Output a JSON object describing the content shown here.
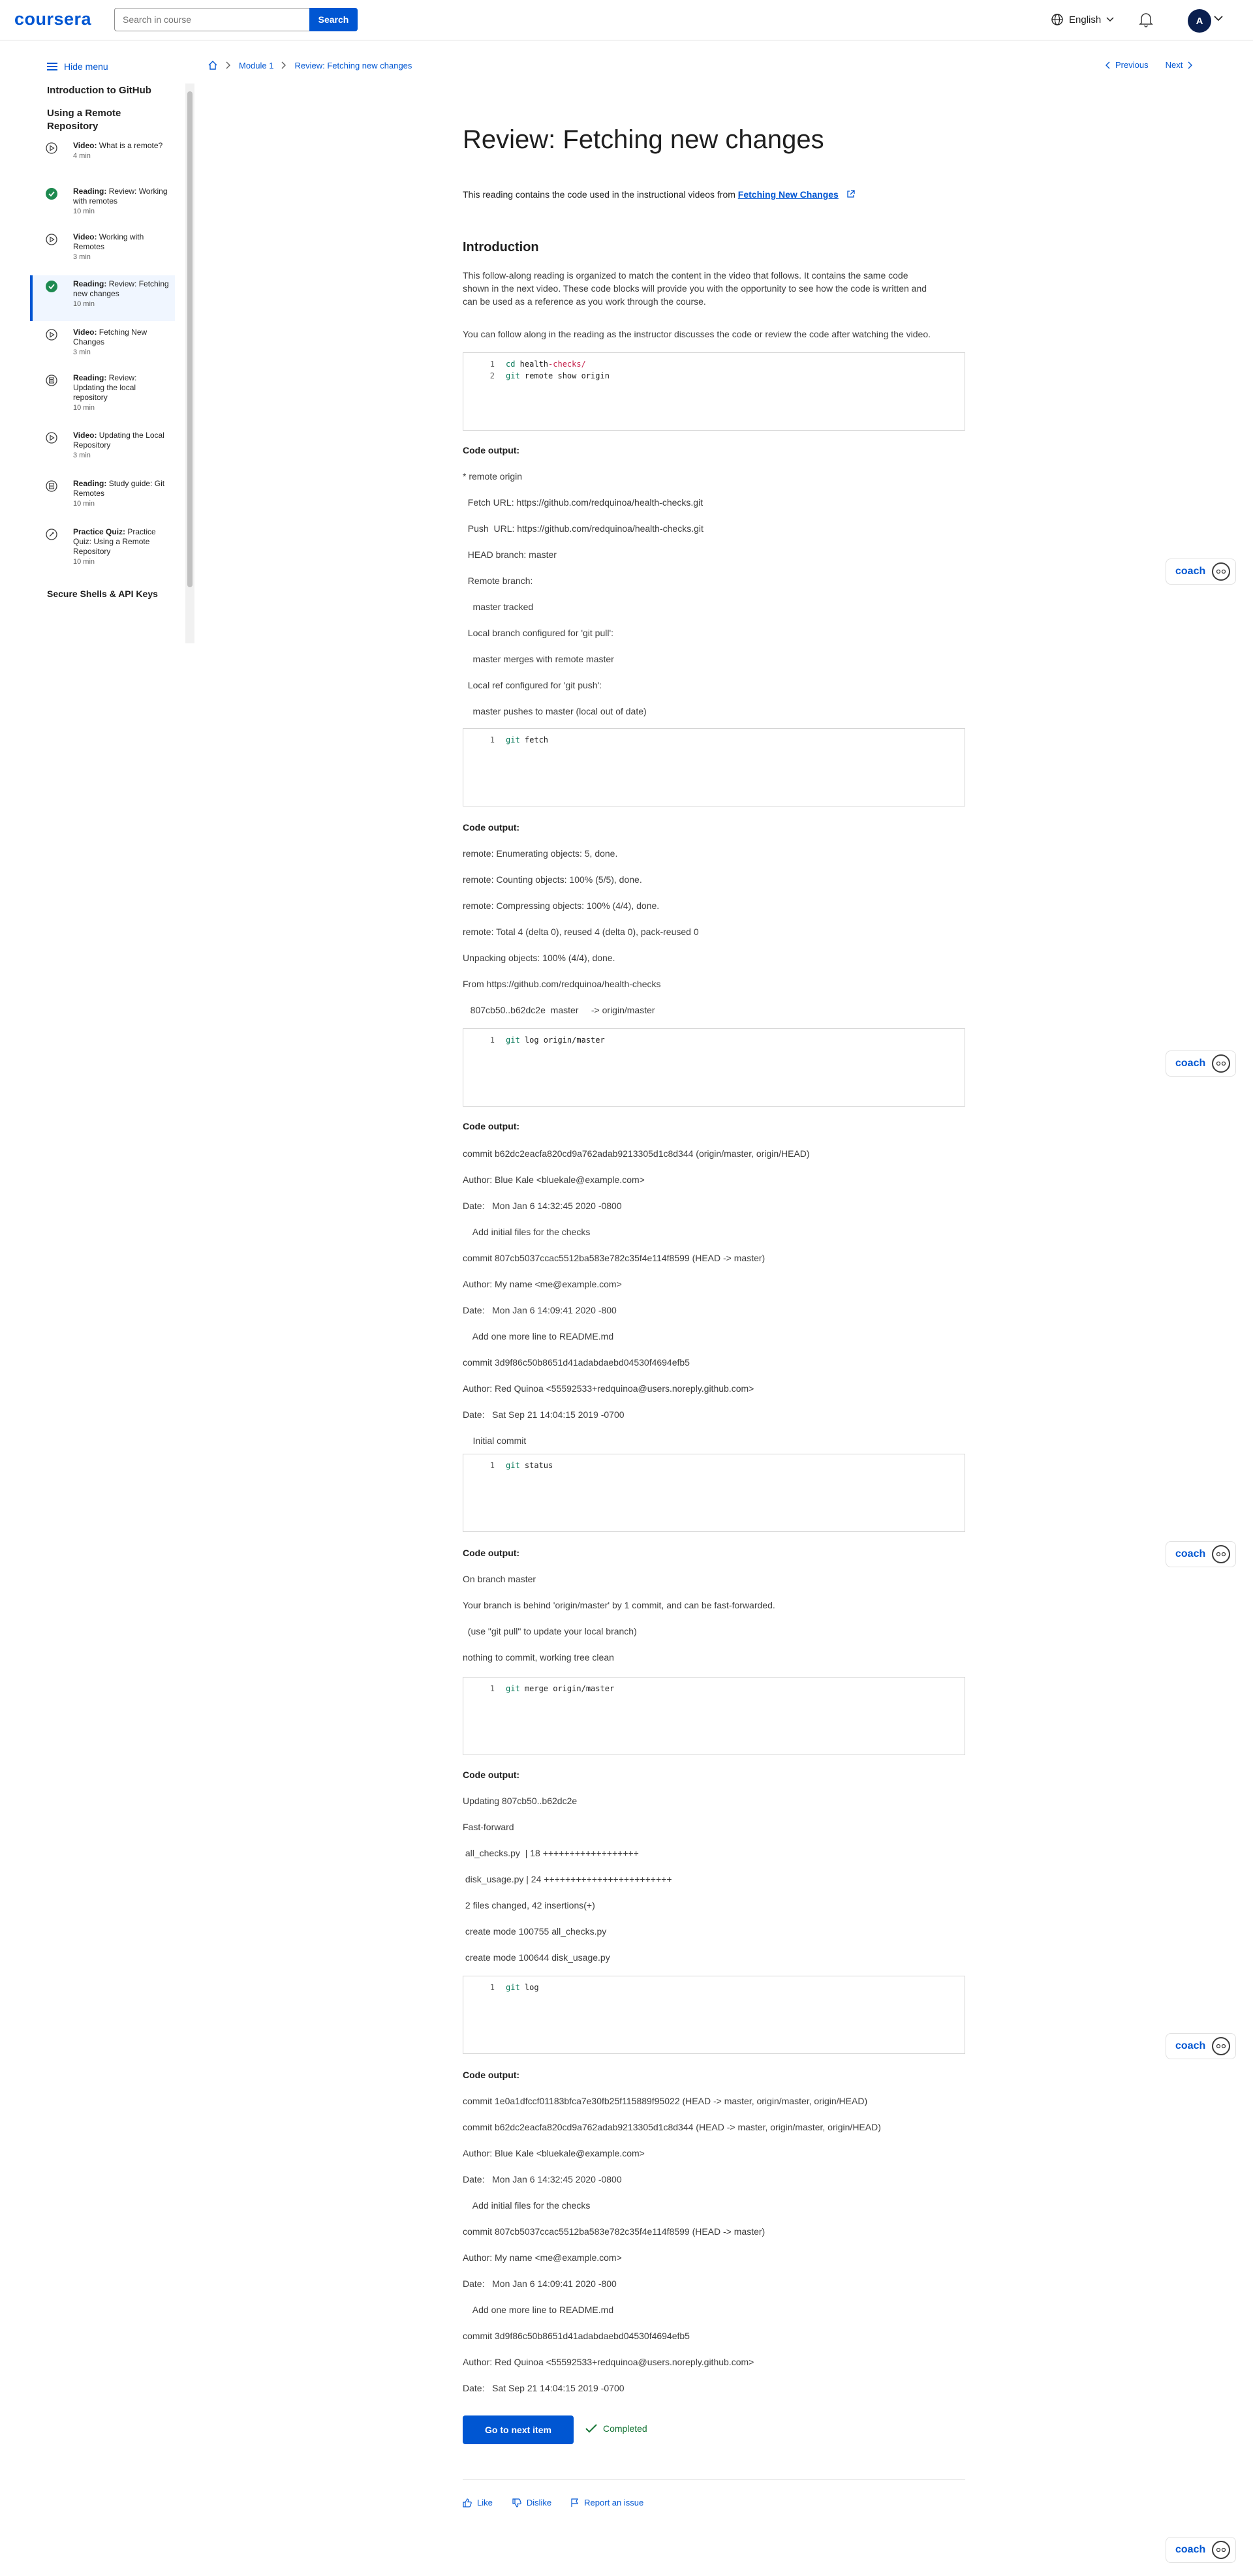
{
  "header": {
    "logo": "coursera",
    "search_placeholder": "Search in course",
    "search_button": "Search",
    "language": "English",
    "avatar_initial": "A"
  },
  "sidebar": {
    "hide_menu": "Hide menu",
    "course_title": "Introduction to GitHub",
    "module_title": "Using a Remote Repository",
    "items": [
      {
        "type": "Video:",
        "title": "What is a remote?",
        "time": "4 min",
        "status": "video"
      },
      {
        "type": "Reading:",
        "title": "Review: Working with remotes",
        "time": "10 min",
        "status": "done"
      },
      {
        "type": "Video:",
        "title": "Working with Remotes",
        "time": "3 min",
        "status": "video"
      },
      {
        "type": "Reading:",
        "title": "Review: Fetching new changes",
        "time": "10 min",
        "status": "done"
      },
      {
        "type": "Video:",
        "title": "Fetching New Changes",
        "time": "3 min",
        "status": "video"
      },
      {
        "type": "Reading:",
        "title": "Review: Updating the local repository",
        "time": "10 min",
        "status": "reading"
      },
      {
        "type": "Video:",
        "title": "Updating the Local Repository",
        "time": "3 min",
        "status": "video"
      },
      {
        "type": "Reading:",
        "title": "Study guide: Git Remotes",
        "time": "10 min",
        "status": "reading"
      },
      {
        "type": "Practice Quiz:",
        "title": "Practice Quiz: Using a Remote Repository",
        "time": "10 min",
        "status": "quiz"
      }
    ],
    "next_section": "Secure Shells & API Keys"
  },
  "breadcrumb": {
    "module": "Module 1",
    "current": "Review: Fetching new changes"
  },
  "pager": {
    "previous": "Previous",
    "next": "Next"
  },
  "content": {
    "title": "Review: Fetching new changes",
    "intro_prefix": "This reading contains the code used in the instructional videos from ",
    "intro_link": "Fetching New Changes",
    "section_heading": "Introduction",
    "para1_line1": "This follow-along reading is organized to match the content in the video that follows. It contains the same code",
    "para1_line2": "shown in the next video. These code blocks will provide you with the opportunity to see how the code is written and",
    "para1_line3": "can be used as a reference as you work through the course.",
    "para2": "You can follow along in the reading as the instructor discusses the code or review the code after watching the video.",
    "code_output_label": "Code output:"
  },
  "code_blocks": [
    {
      "lines": [
        [
          "1",
          "cd health-checks/"
        ],
        [
          "2",
          "git remote show origin"
        ]
      ]
    },
    {
      "lines": [
        [
          "1",
          "git fetch"
        ]
      ]
    },
    {
      "lines": [
        [
          "1",
          "git log origin/master"
        ]
      ]
    },
    {
      "lines": [
        [
          "1",
          "git status"
        ]
      ]
    },
    {
      "lines": [
        [
          "1",
          "git merge origin/master"
        ]
      ]
    },
    {
      "lines": [
        [
          "1",
          "git log"
        ]
      ]
    }
  ],
  "outputs": [
    [
      "* remote origin",
      "  Fetch URL: https://github.com/redquinoa/health-checks.git",
      "  Push  URL: https://github.com/redquinoa/health-checks.git",
      "  HEAD branch: master",
      "  Remote branch:",
      "    master tracked",
      "  Local branch configured for 'git pull':",
      "    master merges with remote master",
      "  Local ref configured for 'git push':",
      "    master pushes to master (local out of date)"
    ],
    [
      "remote: Enumerating objects: 5, done.",
      "remote: Counting objects: 100% (5/5), done.",
      "remote: Compressing objects: 100% (4/4), done.",
      "remote: Total 4 (delta 0), reused 4 (delta 0), pack-reused 0",
      "Unpacking objects: 100% (4/4), done.",
      "From https://github.com/redquinoa/health-checks",
      "   807cb50..b62dc2e  master     -> origin/master"
    ],
    [
      "commit b62dc2eacfa820cd9a762adab9213305d1c8d344 (origin/master, origin/HEAD)",
      "Author: Blue Kale <bluekale@example.com>",
      "Date:   Mon Jan 6 14:32:45 2020 -0800",
      "    Add initial files for the checks",
      "commit 807cb5037ccac5512ba583e782c35f4e114f8599 (HEAD -> master)",
      "Author: My name <me@example.com>",
      "Date:   Mon Jan 6 14:09:41 2020 -800",
      "    Add one more line to README.md",
      "commit 3d9f86c50b8651d41adabdaebd04530f4694efb5",
      "Author: Red Quinoa <55592533+redquinoa@users.noreply.github.com>",
      "Date:   Sat Sep 21 14:04:15 2019 -0700",
      "    Initial commit"
    ],
    [
      "On branch master",
      "Your branch is behind 'origin/master' by 1 commit, and can be fast-forwarded.",
      "  (use \"git pull\" to update your local branch)",
      "nothing to commit, working tree clean"
    ],
    [
      "Updating 807cb50..b62dc2e",
      "Fast-forward",
      " all_checks.py  | 18 ++++++++++++++++++",
      " disk_usage.py | 24 ++++++++++++++++++++++++",
      " 2 files changed, 42 insertions(+)",
      " create mode 100755 all_checks.py",
      " create mode 100644 disk_usage.py"
    ],
    [
      "commit 1e0a1dfccf01183bfca7e30fb25f115889f95022 (HEAD -> master, origin/master, origin/HEAD)",
      "commit b62dc2eacfa820cd9a762adab9213305d1c8d344 (HEAD -> master, origin/master, origin/HEAD)",
      "Author: Blue Kale <bluekale@example.com>",
      "Date:   Mon Jan 6 14:32:45 2020 -0800",
      "    Add initial files for the checks",
      "commit 807cb5037ccac5512ba583e782c35f4e114f8599 (HEAD -> master)",
      "Author: My name <me@example.com>",
      "Date:   Mon Jan 6 14:09:41 2020 -800",
      "    Add one more line to README.md",
      "commit 3d9f86c50b8651d41adabdaebd04530f4694efb5",
      "Author: Red Quinoa <55592533+redquinoa@users.noreply.github.com>",
      "Date:   Sat Sep 21 14:04:15 2019 -0700"
    ]
  ],
  "coach_label": "coach",
  "footer": {
    "next_button": "Go to next item",
    "completed": "Completed",
    "like": "Like",
    "dislike": "Dislike",
    "report": "Report an issue"
  },
  "colors": {
    "brand": "#0056d2",
    "success": "#137333"
  }
}
